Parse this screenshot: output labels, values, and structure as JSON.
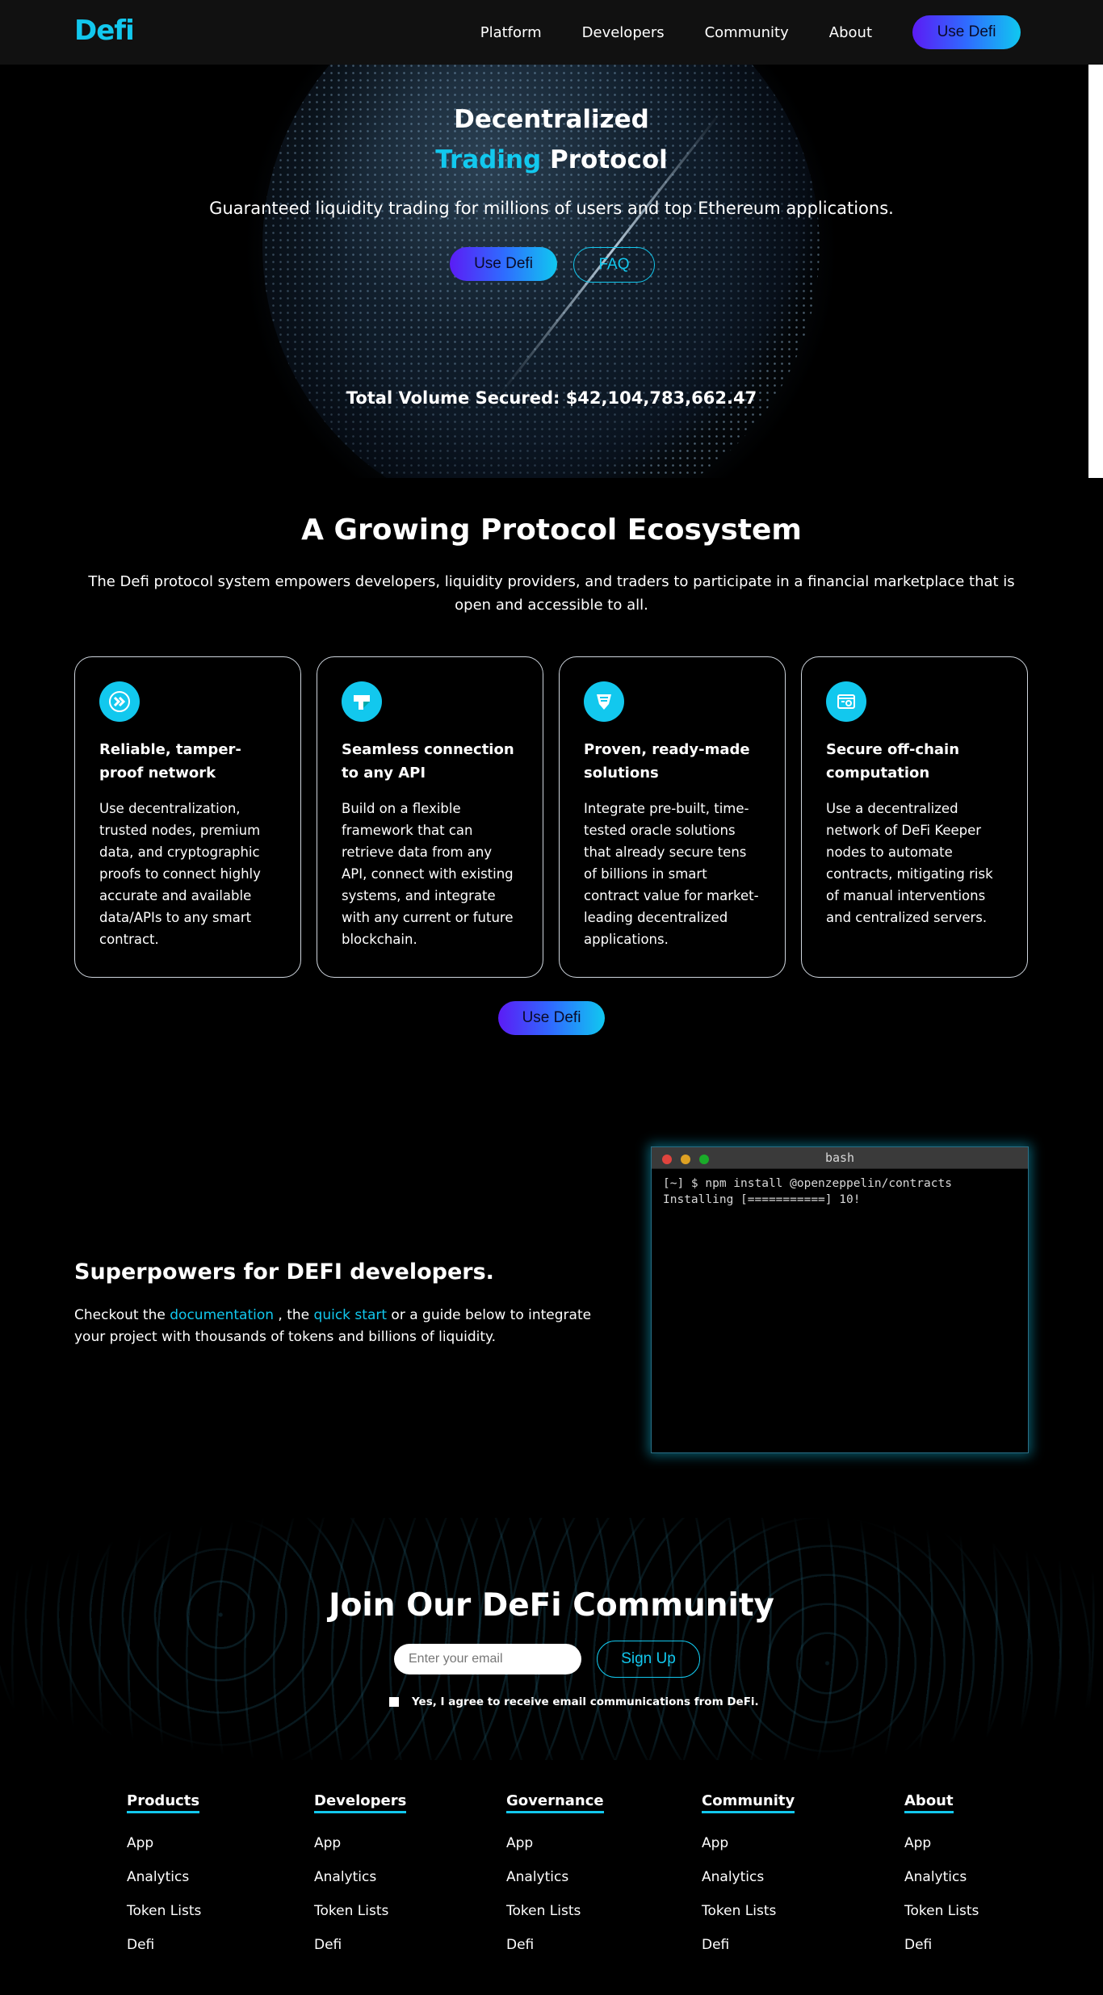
{
  "nav": {
    "logo": "Defi",
    "links": [
      "Platform",
      "Developers",
      "Community",
      "About"
    ],
    "cta": "Use Defi"
  },
  "hero": {
    "title_line1": "Decentralized",
    "title_accent": "Trading",
    "title_rest": " Protocol",
    "subtitle": "Guaranteed liquidity trading for millions of users and top Ethereum applications.",
    "primary_button": "Use Defi",
    "secondary_button": "FAQ",
    "volume": "Total Volume Secured: $42,104,783,662.47"
  },
  "ecosystem": {
    "title": "A Growing Protocol Ecosystem",
    "description": "The Defi protocol system empowers developers, liquidity providers, and traders to participate in a financial marketplace that is open and accessible to all.",
    "cards": [
      {
        "icon": "chevrons-icon",
        "title": "Reliable, tamper-proof network",
        "body": "Use decentralization, trusted nodes, premium data, and cryptographic proofs to connect highly accurate and available data/APIs to any smart contract."
      },
      {
        "icon": "api-connect-icon",
        "title": "Seamless connection to any API",
        "body": "Build on a flexible framework that can retrieve data from any API, connect with existing systems, and integrate with any current or future blockchain."
      },
      {
        "icon": "shield-icon",
        "title": "Proven, ready-made solutions",
        "body": "Integrate pre-built, time-tested oracle solutions that already secure tens of billions in smart contract value for market-leading decentralized applications."
      },
      {
        "icon": "browser-gear-icon",
        "title": "Secure off-chain computation",
        "body": "Use a decentralized network of DeFi Keeper nodes to automate contracts, mitigating risk of manual interventions and centralized servers."
      }
    ],
    "cta": "Use Defi"
  },
  "developers": {
    "title": "Superpowers for DEFI developers.",
    "text_prefix": "Checkout the ",
    "link_docs": "documentation",
    "text_mid": " , the ",
    "link_quickstart": "quick start",
    "text_suffix": " or a guide below to integrate your project with thousands of tokens and billions of liquidity.",
    "terminal": {
      "title": "bash",
      "line1": "[~] $ npm install @openzeppelin/contracts",
      "line2": "Installing [===========] 10!"
    }
  },
  "community": {
    "title": "Join Our DeFi Community",
    "email_placeholder": "Enter your email",
    "signup": "Sign Up",
    "consent": "Yes, I agree to receive email communications from DeFi."
  },
  "footer": {
    "columns": [
      {
        "heading": "Products",
        "items": [
          "App",
          "Analytics",
          "Token Lists",
          "Defi"
        ]
      },
      {
        "heading": "Developers",
        "items": [
          "App",
          "Analytics",
          "Token Lists",
          "Defi"
        ]
      },
      {
        "heading": "Governance",
        "items": [
          "App",
          "Analytics",
          "Token Lists",
          "Defi"
        ]
      },
      {
        "heading": "Community",
        "items": [
          "App",
          "Analytics",
          "Token Lists",
          "Defi"
        ]
      },
      {
        "heading": "About",
        "items": [
          "App",
          "Analytics",
          "Token Lists",
          "Defi"
        ]
      }
    ]
  },
  "colors": {
    "accent": "#12c8ee",
    "gradient_start": "#5b1cf5",
    "gradient_end": "#10c8f0"
  }
}
